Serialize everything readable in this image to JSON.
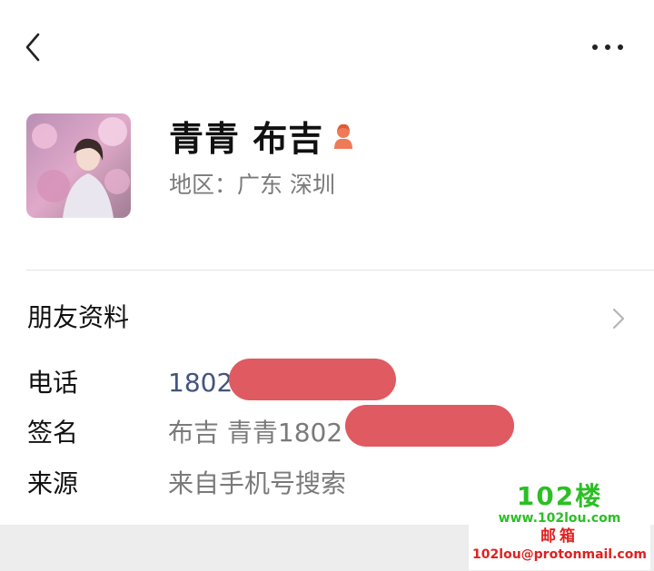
{
  "header": {
    "back_icon": "chevron-left-icon",
    "more_icon": "more-dots-icon"
  },
  "profile": {
    "name": "青青 布吉",
    "gender_icon": "female-user-icon",
    "region": "地区：广东  深圳"
  },
  "section": {
    "title": "朋友资料",
    "chevron_icon": "chevron-right-icon"
  },
  "info": {
    "phone_label": "电话",
    "phone_value": "1802",
    "signature_label": "签名",
    "signature_value": "布吉 青青1802",
    "source_label": "来源",
    "source_value": "来自手机号搜索"
  },
  "watermark": {
    "brand": "102楼",
    "url": "www.102lou.com",
    "mail_title": "邮箱",
    "mail": "102lou@protonmail.com"
  },
  "colors": {
    "redaction": "#df5a61",
    "phone_text": "#44547c",
    "watermark_green": "#2bbf24",
    "watermark_red": "#e02020"
  }
}
